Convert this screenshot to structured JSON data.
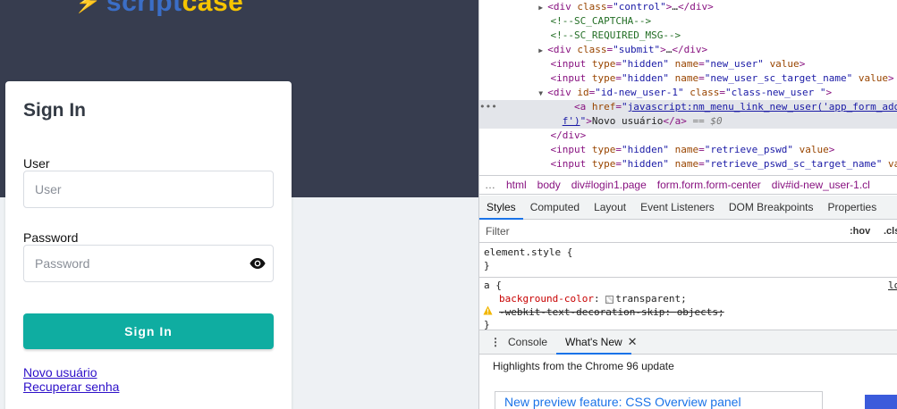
{
  "app": {
    "logo": {
      "part1": "script",
      "part2": "case"
    },
    "signin": {
      "title": "Sign In",
      "user_label": "User",
      "user_placeholder": "User",
      "user_value": "",
      "password_label": "Password",
      "password_placeholder": "Password",
      "password_value": "",
      "button_label": "Sign In",
      "link_new_user": "Novo usuário",
      "link_recover": "Recuperar senha"
    },
    "colors": {
      "hero": "#373d4f",
      "button": "#0fada1",
      "link": "#2d10c9"
    }
  },
  "devtools": {
    "dom_lines": [
      {
        "indent": 1,
        "tri": "▶",
        "html": "div",
        "attrs": [
          [
            "class",
            "control"
          ]
        ],
        "tail": "…</div>"
      },
      {
        "indent": 1,
        "comment": "<!--SC_CAPTCHA-->"
      },
      {
        "indent": 1,
        "comment": "<!--SC_REQUIRED_MSG-->"
      },
      {
        "indent": 1,
        "tri": "▶",
        "html": "div",
        "attrs": [
          [
            "class",
            "submit"
          ]
        ],
        "tail": "…</div>"
      },
      {
        "indent": 1,
        "html": "input",
        "attrs": [
          [
            "type",
            "hidden"
          ],
          [
            "name",
            "new_user"
          ]
        ],
        "bare": "value",
        "tail": ">"
      },
      {
        "indent": 1,
        "html": "input",
        "attrs": [
          [
            "type",
            "hidden"
          ],
          [
            "name",
            "new_user_sc_target_name"
          ]
        ],
        "bare": "value",
        "tail": ">"
      },
      {
        "indent": 1,
        "tri": "▼",
        "html": "div",
        "attrs": [
          [
            "id",
            "id-new_user-1"
          ],
          [
            "class",
            "class-new_user "
          ]
        ],
        "tail": ">"
      }
    ],
    "selected_line_1": "javascript:nm_menu_link_new_user('app_form_add_users",
    "selected_line_2_end": "f')",
    "selected_text": "Novo usuário",
    "selected_eq": "== $0",
    "after_lines": [
      {
        "close": "</div>"
      },
      {
        "html": "input",
        "attrs": [
          [
            "type",
            "hidden"
          ],
          [
            "name",
            "retrieve_pswd"
          ]
        ],
        "bare": "value"
      },
      {
        "html": "input",
        "attrs": [
          [
            "type",
            "hidden"
          ],
          [
            "name",
            "retrieve_pswd_sc_target_name"
          ]
        ],
        "bare": "value"
      }
    ],
    "breadcrumbs": [
      "html",
      "body",
      "div#login1.page",
      "form.form.form-center",
      "div#id-new_user-1.cl"
    ],
    "tabs": [
      "Styles",
      "Computed",
      "Layout",
      "Event Listeners",
      "DOM Breakpoints",
      "Properties"
    ],
    "active_tab": "Styles",
    "filter_placeholder": "Filter",
    "hov_label": ":hov",
    "cls_label": ".cls",
    "element_style": "element.style {",
    "rule_selector": "a {",
    "rule_source": "lo",
    "prop1_name": "background-color",
    "prop1_value": "transparent;",
    "prop2_name": "-webkit-text-decoration-skip",
    "prop2_value": "objects;",
    "drawer_tabs": [
      "Console",
      "What's New"
    ],
    "drawer_active": "What's New",
    "whatsnew_heading": "Highlights from the Chrome 96 update",
    "whatsnew_card_title": "New preview feature: CSS Overview panel"
  }
}
